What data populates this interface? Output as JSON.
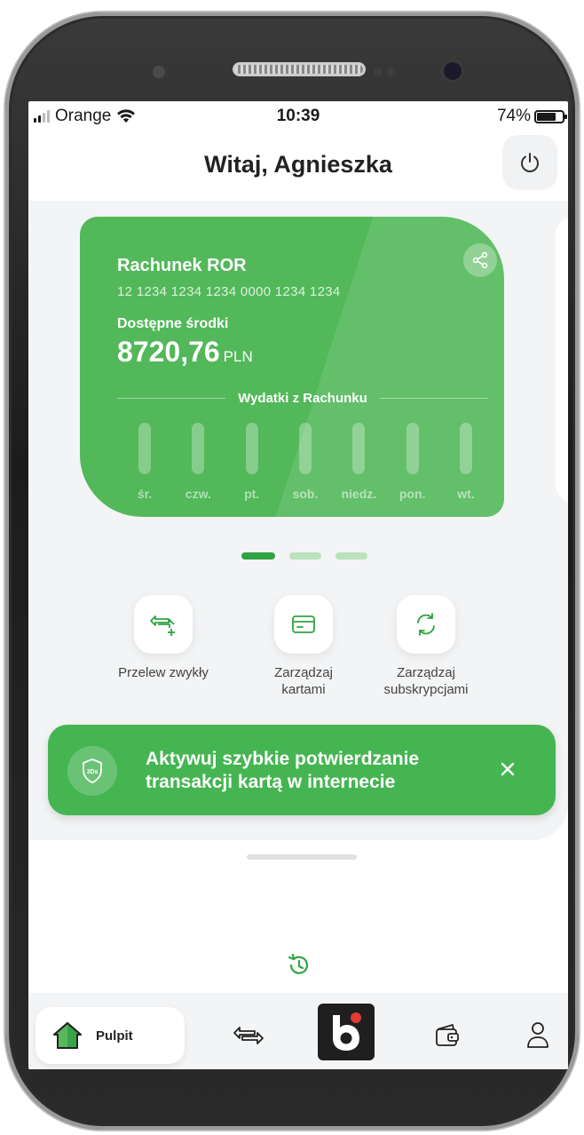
{
  "status_bar": {
    "carrier": "Orange",
    "time": "10:39",
    "battery": "74%"
  },
  "header": {
    "greeting": "Witaj, Agnieszka",
    "power_icon": "power-icon"
  },
  "account_card": {
    "title": "Rachunek ROR",
    "number": "12 1234 1234 1234 0000 1234 1234",
    "available_label": "Dostępne środki",
    "amount": "8720,76",
    "currency": "PLN",
    "share_icon": "share-icon",
    "expenses_title": "Wydatki z Rachunku",
    "days": [
      {
        "label": "śr."
      },
      {
        "label": "czw."
      },
      {
        "label": "pt."
      },
      {
        "label": "sob."
      },
      {
        "label": "niedz."
      },
      {
        "label": "pon."
      },
      {
        "label": "wt."
      }
    ]
  },
  "pager": {
    "count": 3,
    "active": 0
  },
  "quick_actions": [
    {
      "label": "Przelew zwykły",
      "icon": "transfer-add-icon"
    },
    {
      "label": "Zarządzaj kartami",
      "icon": "card-icon"
    },
    {
      "label": "Zarządzaj subskrypcjami",
      "icon": "refresh-icon"
    }
  ],
  "banner": {
    "text": "Aktywuj szybkie potwierdzanie transakcji kartą w internecie",
    "icon": "3ds-shield-icon",
    "badge": "3Ds",
    "close_icon": "close-icon"
  },
  "bottom_nav": {
    "home_label": "Pulpit",
    "items": [
      "home-icon",
      "transfer-icon",
      "bank-logo",
      "wallet-icon",
      "profile-icon"
    ]
  },
  "colors": {
    "accent": "#45b552",
    "accent_dark": "#2ea444",
    "card": "#52b85a"
  }
}
